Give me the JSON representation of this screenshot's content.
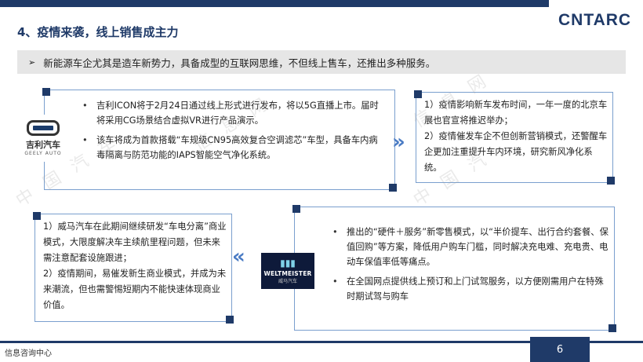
{
  "header": {
    "logo_text": "CNTARC",
    "title": "4、疫情来袭，线上销售成主力"
  },
  "banner": {
    "text": "新能源车企尤其是造车新势力，具备成型的互联网思维，不但线上售车，还推出多种服务。"
  },
  "geely": {
    "logo_name": "吉利汽车",
    "logo_sub": "GEELY AUTO",
    "bullets": [
      "吉利ICON将于2月24日通过线上形式进行发布，将以5G直播上市。届时将采用CG场景结合虚拟VR进行产品演示。",
      "该车将成为首款搭载“车规级CN95高效复合空调滤芯”车型，具备车内病毒隔离与防范功能的IAPS智能空气净化系统。"
    ]
  },
  "right_top": {
    "lines": [
      "1）疫情影响新车发布时间，一年一度的北京车展也官宣将推迟举办；",
      "2）疫情催发车企不但创新营销模式，还警醒车企更加注重提升车内环境，研究新风净化系统。"
    ]
  },
  "left_bottom": {
    "lines": [
      "1）威马汽车在此期间继续研发“车电分离”商业模式，大限度解决车主续航里程问题，但未来需注意配套设施跟进；",
      "2）疫情期间，易催发新生商业模式，并成为未来潮流，但也需警惕短期内不能快速体现商业价值。"
    ]
  },
  "weltmeister": {
    "logo_name": "WELTMEISTER",
    "logo_sub": "威马汽车",
    "bullets": [
      "推出的“硬件＋服务”新零售模式，以“半价提车、出行合约套餐、保值回购”等方案，降低用户购车门槛，同时解决充电难、充电贵、电动车保值率低等痛点。",
      "在全国网点提供线上预订和上门试驾服务，以方便刚需用户在特殊时期试驾与购车"
    ]
  },
  "footer": {
    "left_text": "信息咨询中心",
    "page_number": "6"
  },
  "colors": {
    "primary": "#1f3a68",
    "border": "#7a9fce",
    "banner_bg": "#e6e6e6",
    "accent": "#4a7bc4"
  }
}
